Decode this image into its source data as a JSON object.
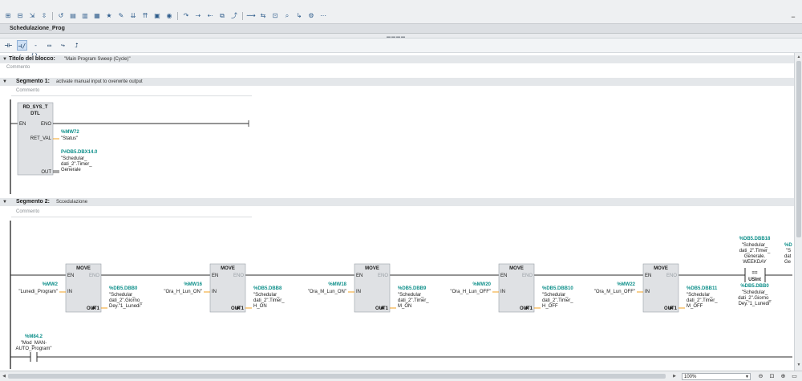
{
  "toolbar": {
    "icons": [
      "insert-network-icon",
      "delete-network-icon",
      "insert-row-icon",
      "add-row-icon",
      "reset-icon",
      "abs-view-icon",
      "symbolic-view-icon",
      "both-view-icon",
      "favorites-icon",
      "network-comments-icon",
      "open-all-icon",
      "close-all-icon",
      "fit-icon",
      "monitor-icon",
      "go-to-icon",
      "next-error-icon",
      "prev-error-icon",
      "call-tree-icon",
      "jump-icon",
      "wire-icon",
      "compare-icon",
      "display-icon",
      "search-icon",
      "jump-to-icon",
      "settings-icon",
      "options-icon"
    ]
  },
  "editor": {
    "block_name": "Schedulazione_Prog",
    "ladder_tools": [
      "-|  |-",
      "-|/|-",
      "-( )-",
      "box",
      "→",
      "⮥"
    ]
  },
  "block_title": {
    "label": "Titolo del blocco:",
    "value": "\"Main Program Sweep (Cycle)\"",
    "comment": "Commento"
  },
  "segment1": {
    "label": "Segmento 1:",
    "title": "activate manual input to overwrite output",
    "comment": "Commento",
    "block": {
      "name_line1": "RD_SYS_T",
      "name_line2": "DTL",
      "en": "EN",
      "eno": "ENO",
      "ret_val": "RET_VAL",
      "out": "OUT",
      "ret_addr": "%MW72",
      "ret_tag": "\"Status\"",
      "out_addr": "P#DB5.DBX14.0",
      "out_tag_line1": "\"Schedular_",
      "out_tag_line2": "dati_2\".Timer_",
      "out_tag_line3": "Generale"
    }
  },
  "segment2": {
    "label": "Segmento 2:",
    "title": "Sccedulazione",
    "comment": "Commento",
    "move_blocks": [
      {
        "name": "MOVE",
        "in_addr": "%MW2",
        "in_tag": "\"Lunedi_Program\"",
        "out_addr": "%DB5.DBB0",
        "out_tag_line1": "\"Schedular_",
        "out_tag_line2": "dati_2\".Giorno_",
        "out_tag_line3": "Dey.\"1_Lunedi\""
      },
      {
        "name": "MOVE",
        "in_addr": "%MW16",
        "in_tag": "\"Ora_H_Lun_ON\"",
        "out_addr": "%DB5.DBB8",
        "out_tag_line1": "\"Schedular_",
        "out_tag_line2": "dati_2\".Timer_",
        "out_tag_line3": "H_ON"
      },
      {
        "name": "MOVE",
        "in_addr": "%MW18",
        "in_tag": "\"Ora_M_Lun_ON\"",
        "out_addr": "%DB5.DBB9",
        "out_tag_line1": "\"Schedular_",
        "out_tag_line2": "dati_2\".Timer_",
        "out_tag_line3": "M_ON"
      },
      {
        "name": "MOVE",
        "in_addr": "%MW20",
        "in_tag": "\"Ora_H_Lun_OFF\"",
        "out_addr": "%DB5.DBB10",
        "out_tag_line1": "\"Schedular_",
        "out_tag_line2": "dati_2\".Timer_",
        "out_tag_line3": "H_OFF"
      },
      {
        "name": "MOVE",
        "in_addr": "%MW22",
        "in_tag": "\"Ora_M_Lun_OFF\"",
        "out_addr": "%DB5.DBB11",
        "out_tag_line1": "\"Schedular_",
        "out_tag_line2": "dati_2\".Timer_",
        "out_tag_line3": "M_OFF"
      }
    ],
    "pin_en": "EN",
    "pin_eno": "ENO",
    "pin_in": "IN",
    "pin_out": "OUT1",
    "compare": {
      "top_addr": "%DB5.DBB18",
      "top_tag_line1": "\"Schedular_",
      "top_tag_line2": "dati_2\".Timer_",
      "top_tag_line3": "Generale.",
      "top_tag_line4": "WEEKDAY",
      "op": "==",
      "type": "USInt",
      "bottom_addr": "%DB5.DBB0",
      "bottom_tag_line1": "\"Schedular_",
      "bottom_tag_line2": "dati_2\".Giorno_",
      "bottom_tag_line3": "Dey.\"1_Lunedi\"",
      "cut_addr": "%D",
      "cut_tag_line1": "\"S",
      "cut_tag_line2": "dat",
      "cut_tag_line3": "Ge"
    },
    "contact": {
      "addr": "%M84.2",
      "tag_line1": "\"Mod_MAN-",
      "tag_line2": "AUTO_Program\""
    }
  },
  "status": {
    "zoom": "100%"
  }
}
